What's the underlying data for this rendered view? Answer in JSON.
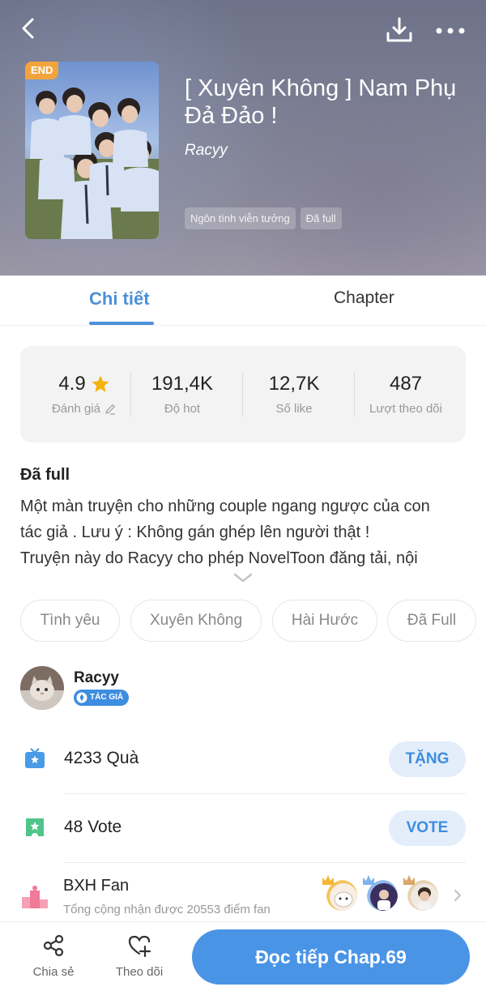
{
  "header": {
    "end_badge": "END",
    "title": "[ Xuyên Không ] Nam Phụ Đả Đảo !",
    "author": "Racyy",
    "genre_tags": [
      "Ngôn tình viễn tưởng",
      "Đã full"
    ]
  },
  "tabs": [
    {
      "label": "Chi tiết",
      "active": true
    },
    {
      "label": "Chapter",
      "active": false
    }
  ],
  "stats": [
    {
      "value": "4.9",
      "label": "Đánh giá",
      "icon": "star-icon"
    },
    {
      "value": "191,4K",
      "label": "Độ hot"
    },
    {
      "value": "12,7K",
      "label": "Số like"
    },
    {
      "value": "487",
      "label": "Lượt theo dõi"
    }
  ],
  "description": {
    "status": "Đã full",
    "line1": "Một màn truyện cho những couple ngang ngược của con",
    "line2": "tác giả . Lưu ý : Không gán ghép lên người thật !",
    "line3": "Truyện này do Racyy cho phép NovelToon đăng tải, nội"
  },
  "keywords": [
    "Tình yêu",
    "Xuyên Không",
    "Hài Hước",
    "Đã Full"
  ],
  "author_block": {
    "name": "Racyy",
    "badge": "TÁC GIẢ"
  },
  "gift": {
    "count_text": "4233 Quà",
    "button": "TẶNG"
  },
  "vote": {
    "count_text": "48 Vote",
    "button": "VOTE"
  },
  "fan_rank": {
    "title": "BXH Fan",
    "subtitle": "Tổng cộng nhận được 20553 điểm fan"
  },
  "bottom_bar": {
    "share": "Chia sẻ",
    "follow": "Theo dõi",
    "read": "Đọc tiếp Chap.69"
  },
  "colors": {
    "accent": "#4a90d9",
    "button_bg": "#e3eefa",
    "badge_orange": "#f2a43c",
    "star": "#f5b20a"
  }
}
